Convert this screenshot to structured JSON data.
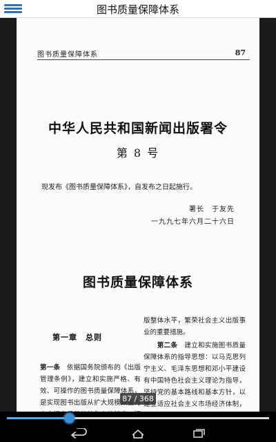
{
  "app_bar": {
    "title": "图书质量保障体系",
    "menu_icon": "hamburger-menu-icon"
  },
  "page": {
    "running_head": "图书质量保障体系",
    "page_number": "87",
    "decree_title": "中华人民共和国新闻出版署令",
    "decree_number": "第 8 号",
    "promulgation": "现发布《图书质量保障体系》，自发布之日起施行。",
    "signer": "署长　于友先",
    "sign_date": "一九九七年六月二十六日",
    "document_title": "图书质量保障体系",
    "chapter_heading": "第一章　总则",
    "article1_label": "第一条",
    "article1_text": "依据国务院颁布的《出版管理条例》，建立和实施严格、有效、可操作的图书质量保障体系，是实现图书出版从扩大规模数量为主向提高质量效益为主的转变，提高图书出",
    "right_col_text": "版整体水平，繁荣社会主义出版事业的重要措施。",
    "article2_label": "第二条",
    "article2_text": "建立和实施图书质量保障体系的指导思想：以马克思列宁主义、毛泽东思想和邓小平建设有中国特色社会主义理论为指导，坚持党的基本路线和基本方针，以建立适应社会主义市场经济体制，符合社会主义精神文明建设要求，体现出版工作"
  },
  "reader": {
    "page_indicator": "87 / 368",
    "current_page": 87,
    "total_pages": 368
  },
  "colors": {
    "accent": "#3a8fd6",
    "menu_icon": "#2f6fb8"
  },
  "nav": {
    "back_icon": "back-arrow-icon",
    "home_icon": "home-icon",
    "recent_icon": "recent-apps-icon"
  }
}
